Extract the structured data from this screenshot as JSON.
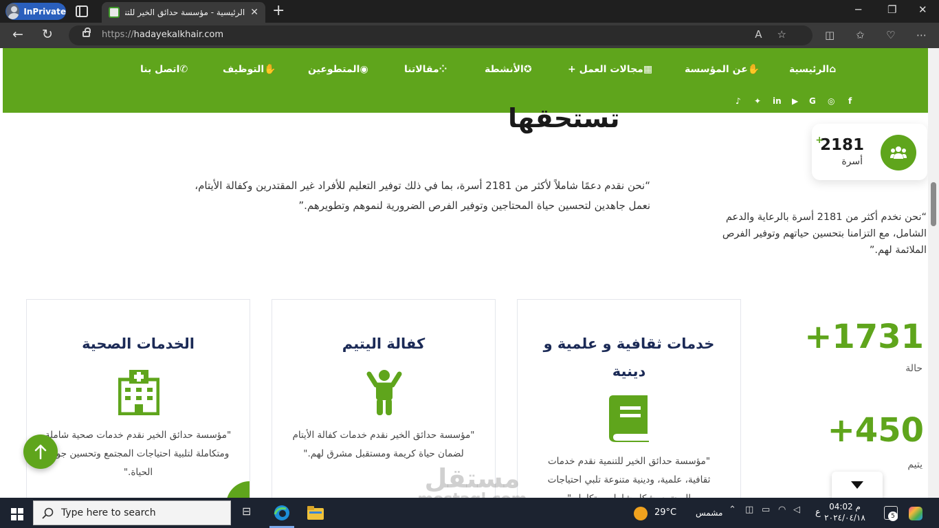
{
  "browser": {
    "inprivate_label": "InPrivate",
    "tab_title": "الرئيسية - مؤسسة حدائق الخير للتنمية",
    "url_protocol": "https://",
    "url_host": "hadayekalkhair.com"
  },
  "nav": {
    "items": [
      {
        "label": "الرئيسية",
        "icon": "home-icon"
      },
      {
        "label": "عن المؤسسة",
        "icon": "hand-icon"
      },
      {
        "label": "مجالات العمل +",
        "icon": "building-icon"
      },
      {
        "label": "الأنشطة",
        "icon": "star-circle-icon"
      },
      {
        "label": "مقالاتنا",
        "icon": "grid-icon"
      },
      {
        "label": "المتطوعين",
        "icon": "user-circle-icon"
      },
      {
        "label": "التوظيف",
        "icon": "hand-icon"
      },
      {
        "label": "اتصل بنا",
        "icon": "phone-icon"
      }
    ],
    "social": [
      "f",
      "ig",
      "G",
      "yt",
      "in",
      "tw",
      "tt"
    ]
  },
  "hero": {
    "heading": "تستحقها"
  },
  "stat_card": {
    "number": "2181",
    "plus": "+",
    "label": "أسرة"
  },
  "quotes": {
    "main": "“نحن نقدم دعمًا شاملاً لأكثر من 2181 أسرة، بما في ذلك توفير التعليم للأفراد غير المقتدرين وكفالة الأيتام، نعمل جاهدين لتحسين حياة المحتاجين وتوفير الفرص الضرورية لنموهم وتطويرهم.”",
    "side": "“نحن نخدم أكثر من 2181 أسرة بالرعاية والدعم الشامل، مع التزامنا بتحسين حياتهم وتوفير الفرص الملائمة لهم.”"
  },
  "cards": [
    {
      "title": "الخدمات الصحية",
      "icon": "hospital-icon",
      "desc": "\"مؤسسة حدائق الخير نقدم خدمات صحية شاملة ومتكاملة لتلبية احتياجات المجتمع وتحسين جودة الحياة.\""
    },
    {
      "title": "كفالة اليتيم",
      "icon": "child-icon",
      "desc": "\"مؤسسة حدائق الخير نقدم خدمات كفالة الأيتام لضمان حياة كريمة ومستقبل مشرق لهم.\""
    },
    {
      "title": "خدمات ثقافية و علمية و دينية",
      "icon": "book-icon",
      "desc": "\"مؤسسة حدائق الخير للتنمية نقدم خدمات ثقافية، علمية، ودينية متنوعة تلبي احتياجات المجتمع بشكل شامل ومتكامل.\""
    }
  ],
  "stats": [
    {
      "value": "+1731",
      "label": "حالة"
    },
    {
      "value": "+450",
      "label": "يتيم"
    }
  ],
  "watermark": {
    "ar": "مستقل",
    "en": "mostaql.com"
  },
  "taskbar": {
    "search_placeholder": "Type here to search",
    "weather_temp": "29°C",
    "weather_label": "مشمس",
    "lang": "ع",
    "time": "04:02 م",
    "date": "٢٠٢٤/٠٤/١٨",
    "notif_count": "5"
  },
  "colors": {
    "brand_green": "#5fa51c",
    "title_navy": "#1b2a56"
  }
}
